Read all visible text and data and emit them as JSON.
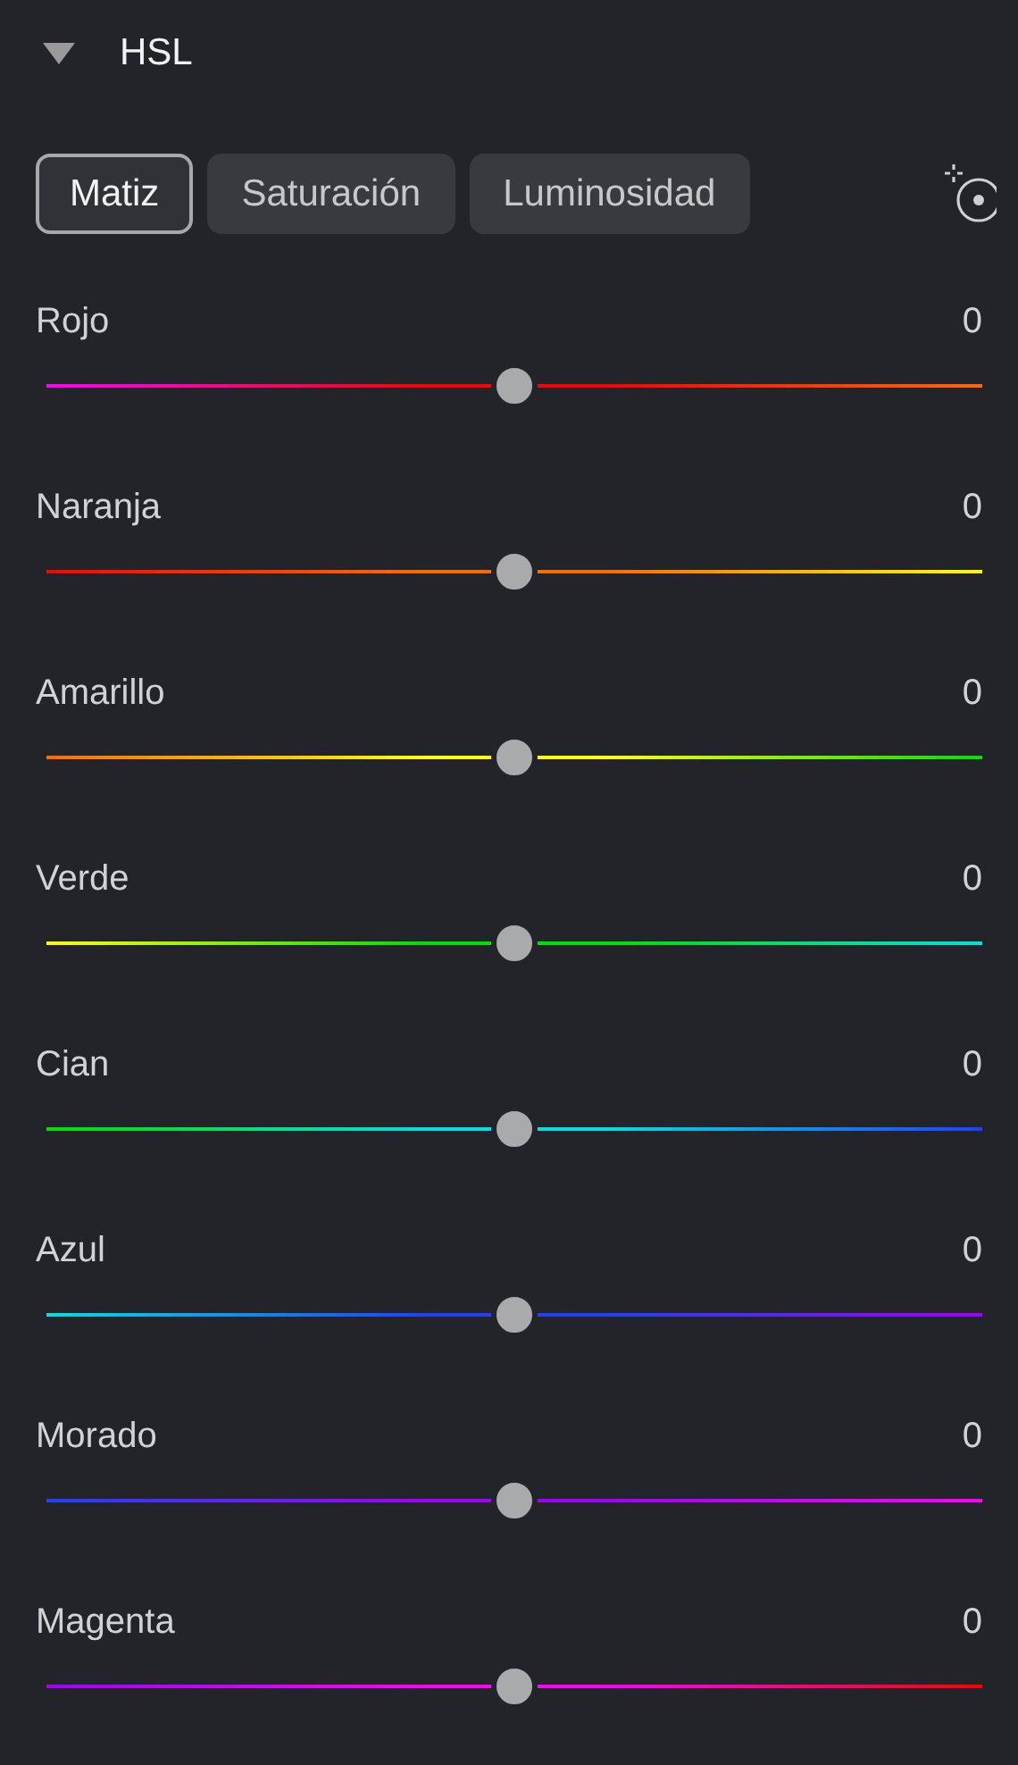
{
  "section": {
    "title": "HSL",
    "expanded": true
  },
  "tabs": [
    {
      "label": "Matiz",
      "selected": true
    },
    {
      "label": "Saturación",
      "selected": false
    },
    {
      "label": "Luminosidad",
      "selected": false
    }
  ],
  "sliders": [
    {
      "label": "Rojo",
      "reading": "0",
      "level": 0.5,
      "color": "#ff0000"
    },
    {
      "label": "Naranja",
      "reading": "0",
      "level": 0.5,
      "color": "#ff6a00"
    },
    {
      "label": "Amarillo",
      "reading": "0",
      "level": 0.5,
      "color": "#ffff00"
    },
    {
      "label": "Verde",
      "reading": "0",
      "level": 0.5,
      "color": "#00e000"
    },
    {
      "label": "Cian",
      "reading": "0",
      "level": 0.5,
      "color": "#00e0e0"
    },
    {
      "label": "Azul",
      "reading": "0",
      "level": 0.5,
      "color": "#2040ff"
    },
    {
      "label": "Morado",
      "reading": "0",
      "level": 0.5,
      "color": "#a000ff"
    },
    {
      "label": "Magenta",
      "reading": "0",
      "level": 0.5,
      "color": "#ff00ff"
    }
  ]
}
